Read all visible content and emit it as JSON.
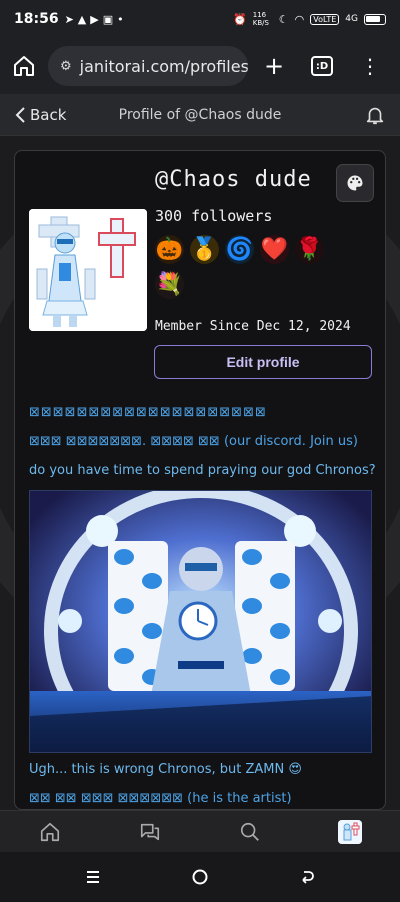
{
  "status_bar": {
    "time": "18:56",
    "network_speed": "116 KB/S",
    "volte": "VoLTE",
    "signal": "4G"
  },
  "browser": {
    "url": "janitorai.com/profiles/",
    "tabs_label": ":D"
  },
  "header": {
    "back_label": "Back",
    "title": "Profile of @Chaos dude"
  },
  "profile": {
    "username": "@Chaos dude",
    "followers": "300 followers",
    "member_since": "Member Since Dec 12, 2024",
    "edit_button": "Edit profile",
    "badges": [
      {
        "name": "pumpkin-badge",
        "glyph": "🎃",
        "bg": "#2a1a0a"
      },
      {
        "name": "coin-badge",
        "glyph": "🥇",
        "bg": "#3a2c08"
      },
      {
        "name": "swirl-badge",
        "glyph": "🌀",
        "bg": "#0e2333"
      },
      {
        "name": "heart-badge",
        "glyph": "❤️",
        "bg": "#2a0e12"
      },
      {
        "name": "roses-badge",
        "glyph": "🌹",
        "bg": "#1e0e10"
      },
      {
        "name": "bouquet-badge",
        "glyph": "💐",
        "bg": "#1e1616"
      }
    ]
  },
  "bio": {
    "symbols_line": "⊠⊠⊠⊠⊠⊠⊠⊠⊠⊠⊠⊠⊠⊠⊠⊠⊠⊠⊠⊠",
    "discord_prefix": "⊠⊠⊠ ⊠⊠⊠⊠⊠⊠⊠. ⊠⊠⊠⊠ ⊠⊠",
    "discord_suffix": "(our discord. Join us)",
    "chronos_question": "do you have time to spend praying our god Chronos?",
    "wrong_chronos": "Ugh... this is wrong Chronos, but ZAMN 😍",
    "artist_prefix": "⊠⊠ ⊠⊠ ⊠⊠⊠ ⊠⊠⊠⊠⊠⊠",
    "artist_suffix": "(he is the artist)"
  },
  "colors": {
    "accent": "#8a7bd6",
    "link": "#4da3e6",
    "background": "#1c1c1e"
  }
}
